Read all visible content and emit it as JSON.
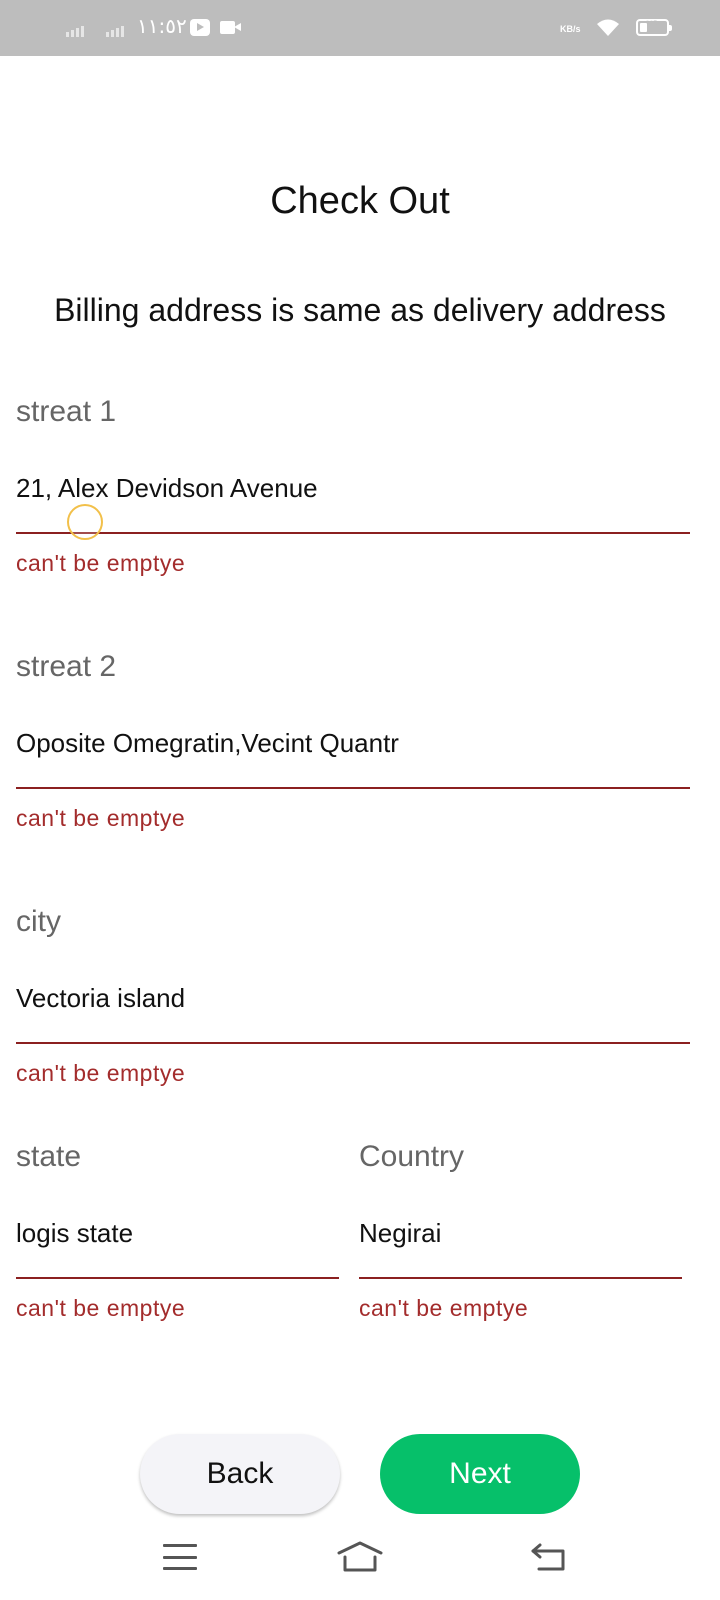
{
  "status_bar": {
    "time": "١١:٥٢",
    "network_speed": "KB/s",
    "battery_level": "٢٩",
    "battery_fraction": 0.29,
    "icons": [
      "signal-icon",
      "signal-icon",
      "youtube-icon",
      "video-camera-icon",
      "wifi-icon",
      "battery-icon"
    ]
  },
  "header": {
    "title": "Check Out",
    "subtitle": "Billing address is same as delivery address"
  },
  "form": {
    "street1": {
      "label": "streat 1",
      "value": "21, Alex Devidson Avenue",
      "error": "can't be emptye"
    },
    "street2": {
      "label": "streat 2",
      "value": "Oposite Omegratin,Vecint Quantr",
      "error": "can't be emptye"
    },
    "city": {
      "label": "city",
      "value": "Vectoria island",
      "error": "can't be emptye"
    },
    "state": {
      "label": "state",
      "value": "logis state",
      "error": "can't be emptye"
    },
    "country": {
      "label": "Country",
      "value": "Negirai",
      "error": "can't be emptye"
    }
  },
  "actions": {
    "back_label": "Back",
    "next_label": "Next"
  },
  "colors": {
    "accent": "#06c06a",
    "error": "#a32c2c",
    "status_bar": "#bdbdbd"
  },
  "nav_bar": {
    "icons": [
      "menu-icon",
      "home-icon",
      "back-icon"
    ]
  }
}
